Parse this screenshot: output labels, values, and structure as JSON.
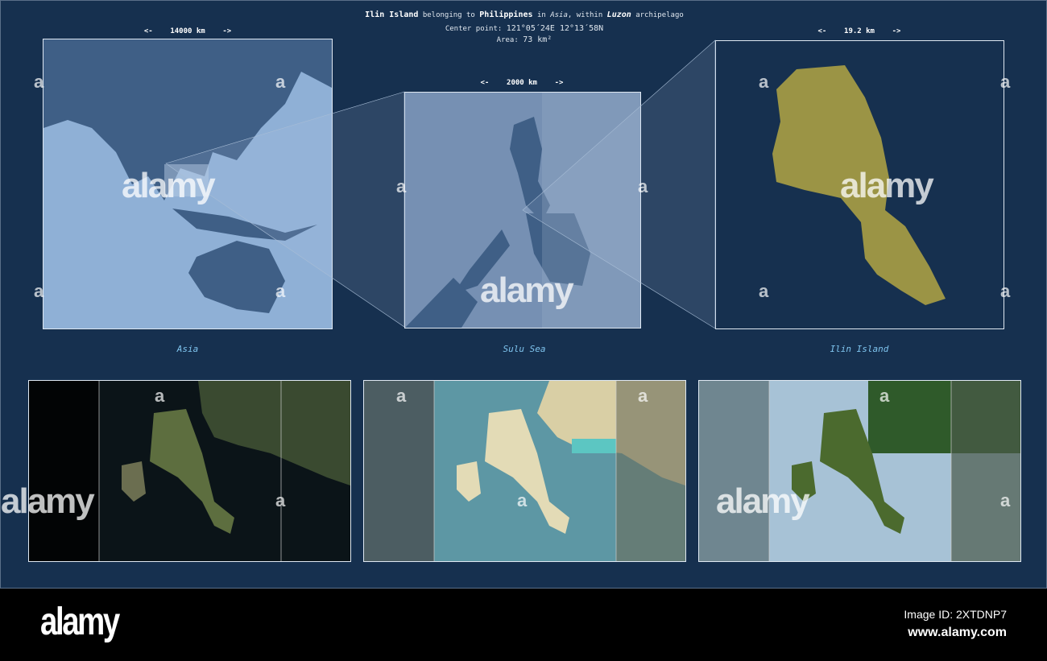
{
  "header": {
    "island": "Ilin Island",
    "t1": "belonging to",
    "country": "Philippines",
    "t2": "in",
    "continent": "Asia",
    "t3": ", within",
    "archipelago": "Luzon",
    "t4": "archipelago",
    "center_label": "Center point:",
    "center_value": "121°05´24E  12°13´58N",
    "area_label": "Area:",
    "area_value": "73 km²"
  },
  "panels": [
    {
      "label": "Asia",
      "scale": "<-    14000 km    ->"
    },
    {
      "label": "Sulu Sea",
      "scale": "<-    2000 km    ->"
    },
    {
      "label": "Ilin Island",
      "scale": "<-    19.2 km    ->"
    }
  ],
  "watermark": {
    "text": "alamy",
    "small": "a"
  },
  "footer": {
    "logo": "alamy",
    "image_id": "Image ID: 2XTDNP7",
    "url": "www.alamy.com"
  },
  "colors": {
    "background": "#16304f",
    "island": "#9b9445",
    "land": "#3f5f86",
    "sea": "#8fb0d6"
  }
}
